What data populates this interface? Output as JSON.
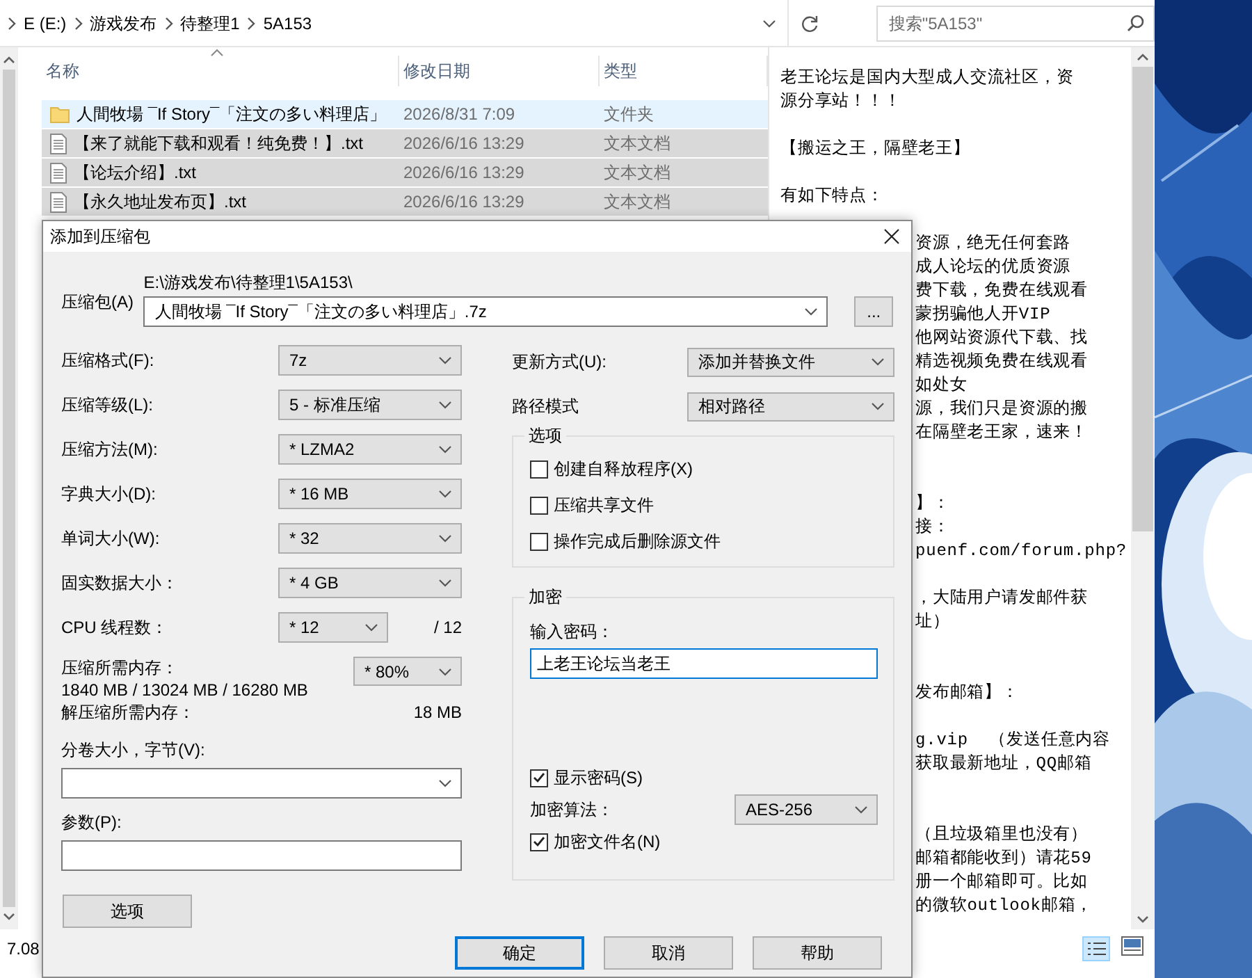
{
  "address_bar": {
    "crumbs": [
      "E (E:)",
      "游戏发布",
      "待整理1",
      "5A153"
    ],
    "search_placeholder": "搜索\"5A153\""
  },
  "file_list": {
    "columns": [
      "名称",
      "修改日期",
      "类型"
    ],
    "rows": [
      {
        "name": "人間牧場 ¯If Story¯「注文の多い料理店」",
        "modified": "2026/8/31 7:09",
        "type": "文件夹",
        "kind": "folder",
        "hover": true,
        "selected": false
      },
      {
        "name": "【来了就能下载和观看！纯免费！】.txt",
        "modified": "2026/6/16 13:29",
        "type": "文本文档",
        "kind": "text",
        "hover": false,
        "selected": true
      },
      {
        "name": "【论坛介绍】.txt",
        "modified": "2026/6/16 13:29",
        "type": "文本文档",
        "kind": "text",
        "hover": false,
        "selected": true
      },
      {
        "name": "【永久地址发布页】.txt",
        "modified": "2026/6/16 13:29",
        "type": "文本文档",
        "kind": "text",
        "hover": false,
        "selected": true
      }
    ]
  },
  "preview": {
    "blocks": [
      {
        "lines": [
          "老王论坛是国内大型成人交流社区，资",
          "源分享站！！！"
        ]
      },
      {
        "lines": [
          "【搬运之王，隔壁老王】"
        ],
        "blank_before": true
      },
      {
        "lines": [
          "有如下特点："
        ],
        "blank_before": true
      },
      {
        "lines": [
          "资源，绝无任何套路",
          "成人论坛的优质资源",
          "费下载，免费在线观看",
          "蒙拐骗他人开VIP",
          "他网站资源代下载、找",
          "精选视频免费在线观看",
          "如处女",
          "源，我们只是资源的搬",
          "在隔壁老王家，速来！"
        ],
        "blank_before": true,
        "clipped": true
      },
      {
        "lines": [
          "】：",
          "接：",
          "puenf.com/forum.php?"
        ],
        "blank_before": true,
        "extra_blank": true,
        "clipped": true
      },
      {
        "lines": [
          "，大陆用户请发邮件获",
          "址）"
        ],
        "blank_before": true,
        "clipped": true
      },
      {
        "lines": [
          "发布邮箱】："
        ],
        "blank_before": true,
        "extra_blank": true,
        "clipped": true
      },
      {
        "lines": [
          "g.vip  （发送任意内容",
          "获取最新地址，QQ邮箱"
        ],
        "blank_before": true,
        "clipped": true
      },
      {
        "lines": [
          "（且垃圾箱里也没有）",
          "邮箱都能收到）请花59",
          "册一个邮箱即可。比如",
          "的微软outlook邮箱，"
        ],
        "blank_before": true,
        "extra_blank": true,
        "clipped": true
      }
    ]
  },
  "status_bar": {
    "text": "7.08"
  },
  "dialog": {
    "title": "添加到压缩包",
    "archive": {
      "label": "压缩包(A)",
      "path": "E:\\游戏发布\\待整理1\\5A153\\",
      "value": "人間牧場 ¯If Story¯「注文の多い料理店」.7z",
      "browse": "..."
    },
    "settings": [
      {
        "label": "压缩格式(F):",
        "value": "7z"
      },
      {
        "label": "压缩等级(L):",
        "value": "5 - 标准压缩"
      },
      {
        "label": "压缩方法(M):",
        "value": "* LZMA2"
      },
      {
        "label": "字典大小(D):",
        "value": "* 16 MB"
      },
      {
        "label": "单词大小(W):",
        "value": "* 32"
      },
      {
        "label": "固实数据大小：",
        "value": "* 4 GB"
      },
      {
        "label": "CPU 线程数：",
        "value": "* 12",
        "suffix": "/ 12"
      }
    ],
    "memory": {
      "label": "压缩所需内存：",
      "detail": "1840 MB / 13024 MB / 16280 MB",
      "value": "* 80%"
    },
    "decompress_memory": {
      "label": "解压缩所需内存：",
      "value": "18 MB"
    },
    "volume": {
      "label": "分卷大小，字节(V):"
    },
    "parameters": {
      "label": "参数(P):"
    },
    "options_button": "选项",
    "update_mode": {
      "label": "更新方式(U):",
      "value": "添加并替换文件"
    },
    "path_mode": {
      "label": "路径模式",
      "value": "相对路径"
    },
    "options_group": {
      "title": "选项",
      "items": [
        {
          "label": "创建自释放程序(X)",
          "checked": false
        },
        {
          "label": "压缩共享文件",
          "checked": false
        },
        {
          "label": "操作完成后删除源文件",
          "checked": false
        }
      ]
    },
    "encryption": {
      "title": "加密",
      "password_label": "输入密码：",
      "password": "上老王论坛当老王",
      "password_focused": true,
      "show_password": {
        "label": "显示密码(S)",
        "checked": true
      },
      "method_label": "加密算法：",
      "method": "AES-256",
      "encrypt_names": {
        "label": "加密文件名(N)",
        "checked": true
      }
    },
    "buttons": [
      {
        "label": "确定",
        "default": true
      },
      {
        "label": "取消",
        "default": false
      },
      {
        "label": "帮助",
        "default": false
      }
    ]
  }
}
